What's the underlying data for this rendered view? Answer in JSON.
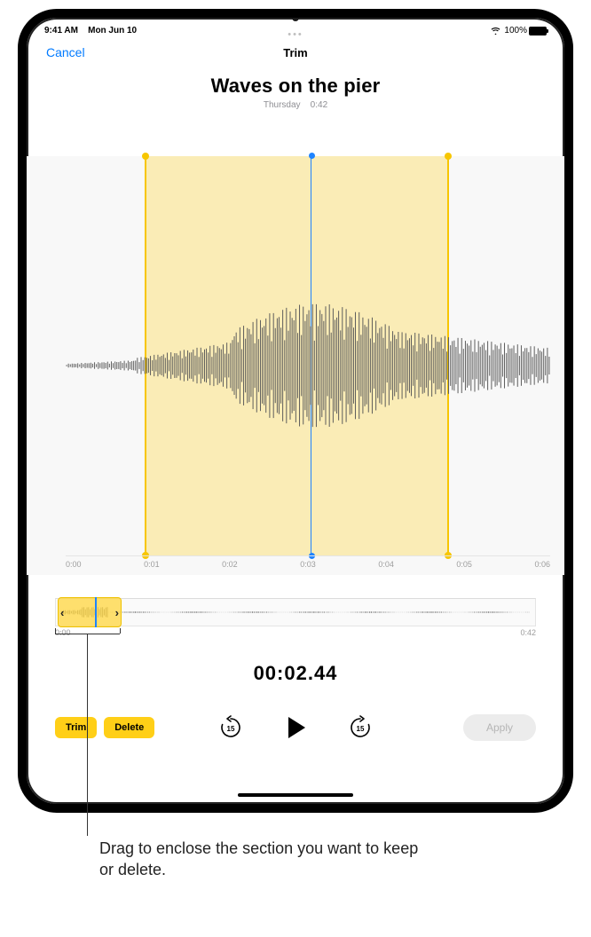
{
  "statusbar": {
    "time": "9:41 AM",
    "date": "Mon Jun 10",
    "battery_pct": "100%"
  },
  "nav": {
    "cancel": "Cancel",
    "title": "Trim"
  },
  "recording": {
    "title": "Waves on the pier",
    "day": "Thursday",
    "duration": "0:42"
  },
  "ruler_main": [
    "0:00",
    "0:01",
    "0:02",
    "0:03",
    "0:04",
    "0:05",
    "0:06"
  ],
  "ruler_mini_start": "0:00",
  "ruler_mini_end": "0:42",
  "timecode": "00:02.44",
  "controls": {
    "trim": "Trim",
    "delete": "Delete",
    "skip_seconds": "15",
    "apply": "Apply"
  },
  "callout": "Drag to enclose the section you want to keep or delete.",
  "colors": {
    "link": "#007aff",
    "accent": "#ffcf17",
    "playhead": "#1e83ff",
    "selection": "rgba(255,214,61,0.35)"
  }
}
